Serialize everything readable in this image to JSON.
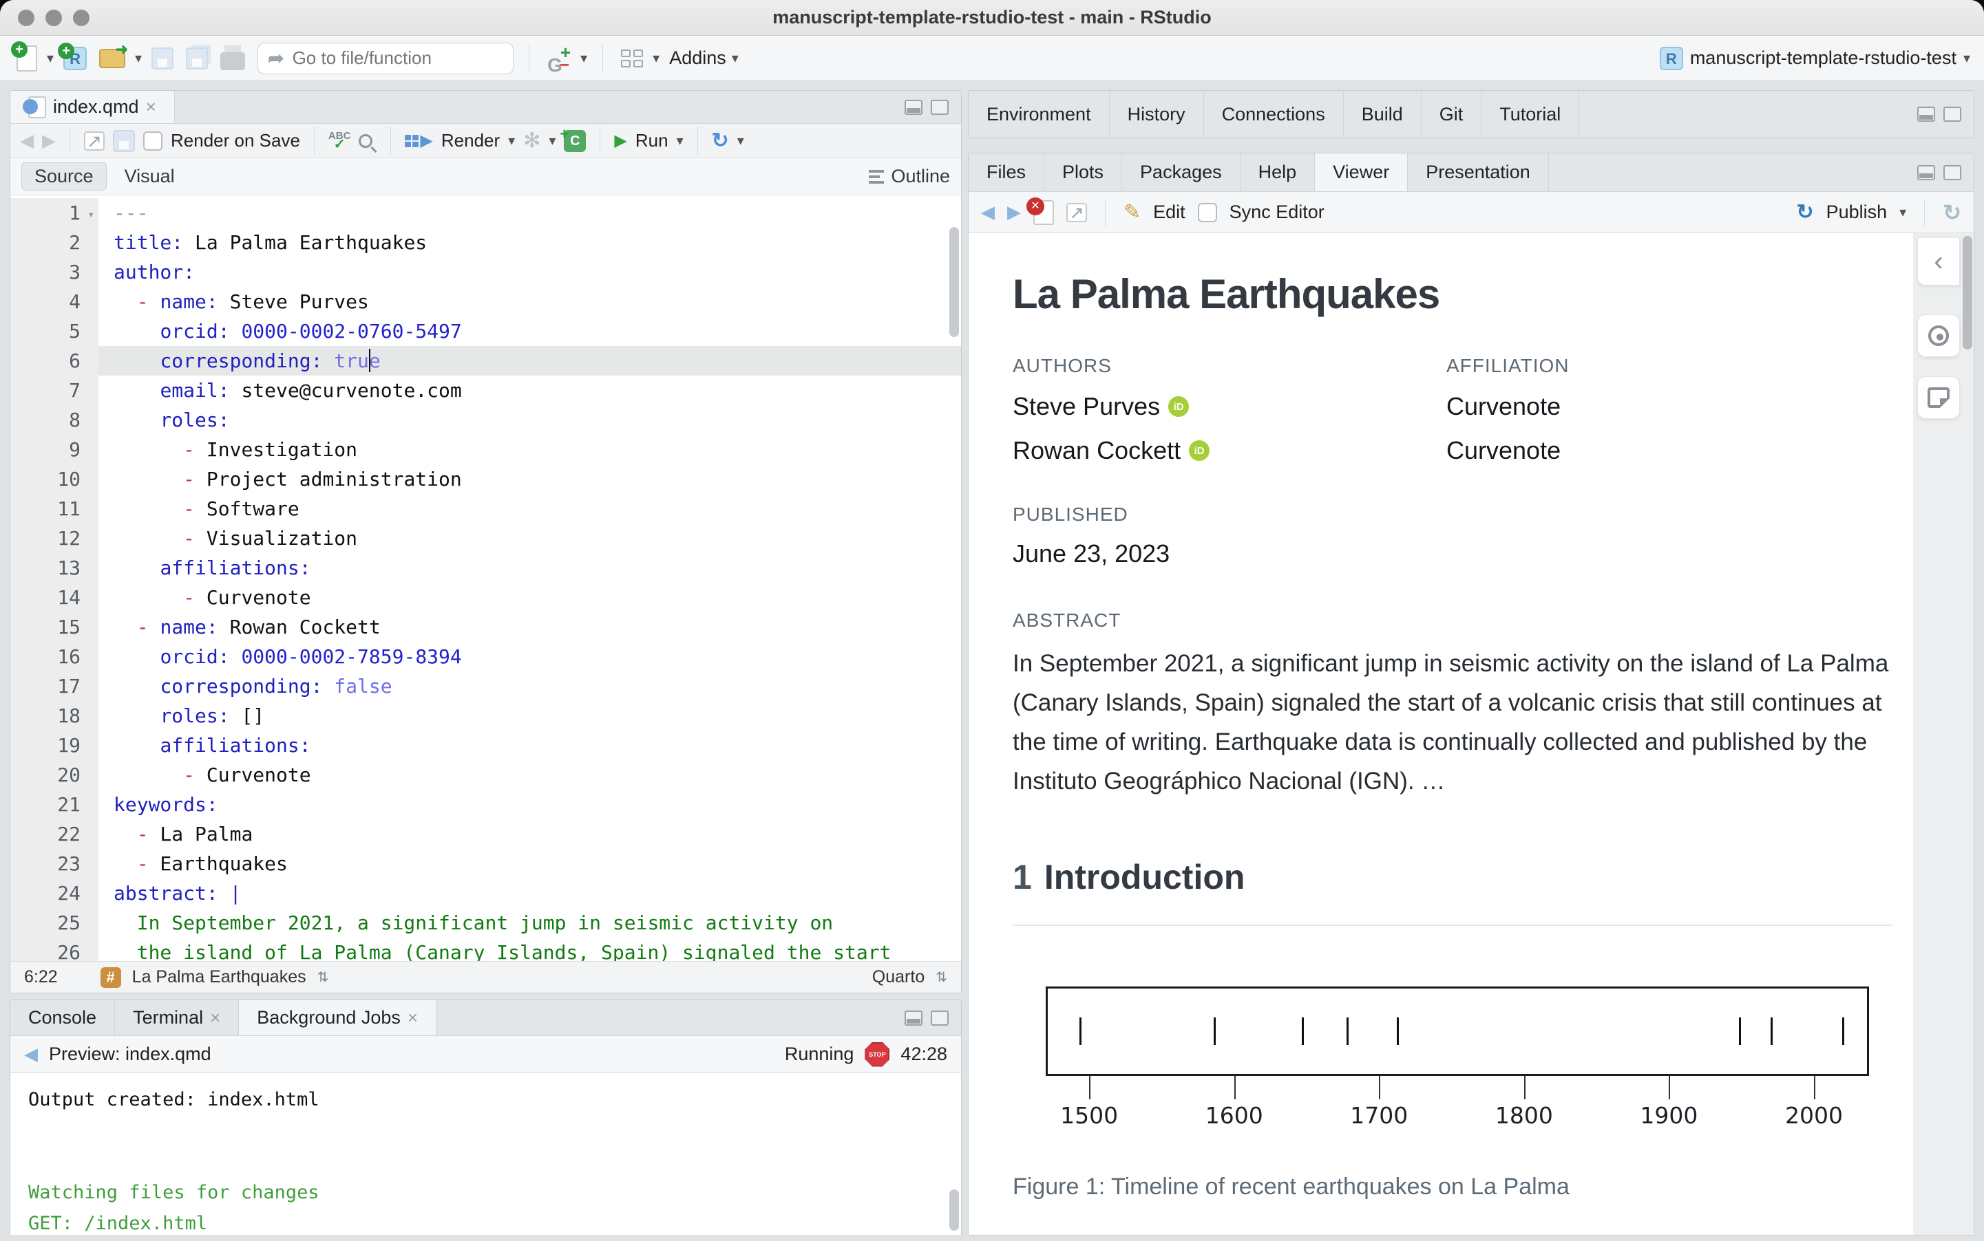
{
  "window": {
    "title": "manuscript-template-rstudio-test - main - RStudio"
  },
  "main_toolbar": {
    "goto_placeholder": "Go to file/function",
    "addins_label": "Addins",
    "project_name": "manuscript-template-rstudio-test"
  },
  "editor": {
    "tab": "index.qmd",
    "toolbar": {
      "render_on_save": "Render on Save",
      "render_label": "Render",
      "run_label": "Run"
    },
    "views": {
      "source": "Source",
      "visual": "Visual",
      "outline": "Outline"
    },
    "cursor": {
      "line": 6,
      "col": 22
    },
    "lines": [
      {
        "n": 1,
        "s": [
          [
            "meta",
            "---"
          ]
        ]
      },
      {
        "n": 2,
        "s": [
          [
            "key",
            "title:"
          ],
          [
            "txt",
            " La Palma Earthquakes"
          ]
        ]
      },
      {
        "n": 3,
        "s": [
          [
            "key",
            "author:"
          ]
        ]
      },
      {
        "n": 4,
        "s": [
          [
            "txt",
            "  "
          ],
          [
            "dash",
            "-"
          ],
          [
            "txt",
            " "
          ],
          [
            "key",
            "name:"
          ],
          [
            "txt",
            " Steve Purves"
          ]
        ]
      },
      {
        "n": 5,
        "s": [
          [
            "txt",
            "    "
          ],
          [
            "key",
            "orcid:"
          ],
          [
            "num",
            " 0000-0002-0760-5497"
          ]
        ]
      },
      {
        "n": 6,
        "s": [
          [
            "txt",
            "    "
          ],
          [
            "key",
            "corresponding:"
          ],
          [
            "bool",
            " true"
          ]
        ]
      },
      {
        "n": 7,
        "s": [
          [
            "txt",
            "    "
          ],
          [
            "key",
            "email:"
          ],
          [
            "txt",
            " steve@curvenote.com"
          ]
        ]
      },
      {
        "n": 8,
        "s": [
          [
            "txt",
            "    "
          ],
          [
            "key",
            "roles:"
          ]
        ]
      },
      {
        "n": 9,
        "s": [
          [
            "txt",
            "      "
          ],
          [
            "dash",
            "-"
          ],
          [
            "txt",
            " Investigation"
          ]
        ]
      },
      {
        "n": 10,
        "s": [
          [
            "txt",
            "      "
          ],
          [
            "dash",
            "-"
          ],
          [
            "txt",
            " Project administration"
          ]
        ]
      },
      {
        "n": 11,
        "s": [
          [
            "txt",
            "      "
          ],
          [
            "dash",
            "-"
          ],
          [
            "txt",
            " Software"
          ]
        ]
      },
      {
        "n": 12,
        "s": [
          [
            "txt",
            "      "
          ],
          [
            "dash",
            "-"
          ],
          [
            "txt",
            " Visualization"
          ]
        ]
      },
      {
        "n": 13,
        "s": [
          [
            "txt",
            "    "
          ],
          [
            "key",
            "affiliations:"
          ]
        ]
      },
      {
        "n": 14,
        "s": [
          [
            "txt",
            "      "
          ],
          [
            "dash",
            "-"
          ],
          [
            "txt",
            " Curvenote"
          ]
        ]
      },
      {
        "n": 15,
        "s": [
          [
            "txt",
            "  "
          ],
          [
            "dash",
            "-"
          ],
          [
            "txt",
            " "
          ],
          [
            "key",
            "name:"
          ],
          [
            "txt",
            " Rowan Cockett"
          ]
        ]
      },
      {
        "n": 16,
        "s": [
          [
            "txt",
            "    "
          ],
          [
            "key",
            "orcid:"
          ],
          [
            "num",
            " 0000-0002-7859-8394"
          ]
        ]
      },
      {
        "n": 17,
        "s": [
          [
            "txt",
            "    "
          ],
          [
            "key",
            "corresponding:"
          ],
          [
            "bool",
            " false"
          ]
        ]
      },
      {
        "n": 18,
        "s": [
          [
            "txt",
            "    "
          ],
          [
            "key",
            "roles:"
          ],
          [
            "txt",
            " []"
          ]
        ]
      },
      {
        "n": 19,
        "s": [
          [
            "txt",
            "    "
          ],
          [
            "key",
            "affiliations:"
          ]
        ]
      },
      {
        "n": 20,
        "s": [
          [
            "txt",
            "      "
          ],
          [
            "dash",
            "-"
          ],
          [
            "txt",
            " Curvenote"
          ]
        ]
      },
      {
        "n": 21,
        "s": [
          [
            "key",
            "keywords:"
          ]
        ]
      },
      {
        "n": 22,
        "s": [
          [
            "txt",
            "  "
          ],
          [
            "dash",
            "-"
          ],
          [
            "txt",
            " La Palma"
          ]
        ]
      },
      {
        "n": 23,
        "s": [
          [
            "txt",
            "  "
          ],
          [
            "dash",
            "-"
          ],
          [
            "txt",
            " Earthquakes"
          ]
        ]
      },
      {
        "n": 24,
        "s": [
          [
            "key",
            "abstract:"
          ],
          [
            "key",
            " |"
          ]
        ]
      },
      {
        "n": 25,
        "s": [
          [
            "str",
            "  In September 2021, a significant jump in seismic activity on"
          ]
        ]
      },
      {
        "n": 26,
        "s": [
          [
            "str",
            "  the island of La Palma (Canary Islands, Spain) signaled the start"
          ]
        ]
      }
    ],
    "status": {
      "position": "6:22",
      "scope": "La Palma Earthquakes",
      "mode": "Quarto"
    }
  },
  "console": {
    "tabs": [
      {
        "label": "Console",
        "closable": false
      },
      {
        "label": "Terminal",
        "closable": true
      },
      {
        "label": "Background Jobs",
        "closable": true
      }
    ],
    "active": "Background Jobs",
    "preview_label": "Preview: index.qmd",
    "status": "Running",
    "stop_label": "STOP",
    "elapsed": "42:28",
    "output": [
      {
        "style": "plain",
        "text": "Output created: index.html"
      },
      {
        "style": "plain",
        "text": ""
      },
      {
        "style": "plain",
        "text": ""
      },
      {
        "style": "green",
        "text": "Watching files for changes"
      },
      {
        "style": "green",
        "text": "GET: /index.html"
      }
    ]
  },
  "right_top": {
    "tabs": [
      "Environment",
      "History",
      "Connections",
      "Build",
      "Git",
      "Tutorial"
    ]
  },
  "viewer": {
    "tabs": [
      "Files",
      "Plots",
      "Packages",
      "Help",
      "Viewer",
      "Presentation"
    ],
    "active": "Viewer",
    "toolbar": {
      "edit": "Edit",
      "sync_editor": "Sync Editor",
      "publish": "Publish"
    }
  },
  "document": {
    "title": "La Palma Earthquakes",
    "authors_label": "AUTHORS",
    "affiliation_label": "AFFILIATION",
    "authors": [
      {
        "name": "Steve Purves",
        "affiliation": "Curvenote"
      },
      {
        "name": "Rowan Cockett",
        "affiliation": "Curvenote"
      }
    ],
    "published_label": "PUBLISHED",
    "published": "June 23, 2023",
    "abstract_label": "ABSTRACT",
    "abstract": "In September 2021, a significant jump in seismic activity on the island of La Palma (Canary Islands, Spain) signaled the start of a volcanic crisis that still continues at the time of writing. Earthquake data is continually collected and published by the Instituto Geográphico Nacional (IGN). …",
    "section": {
      "number": "1",
      "title": "Introduction"
    },
    "figure_caption": "Figure 1: Timeline of recent earthquakes on La Palma"
  },
  "chart_data": {
    "type": "rug-timeline",
    "title": "Timeline of recent earthquakes on La Palma",
    "events_years": [
      1492,
      1585,
      1646,
      1677,
      1712,
      1949,
      1971,
      2021
    ],
    "x_ticks": [
      1500,
      1600,
      1700,
      1800,
      1900,
      2000
    ],
    "xlim": [
      1470,
      2038
    ],
    "xlabel": "",
    "ylabel": "",
    "grid": false,
    "caption": "Figure 1: Timeline of recent earthquakes on La Palma"
  },
  "colors": {
    "accent_blue": "#4c8dd2",
    "orcid_green": "#a6ce39",
    "stop_red": "#d8383f",
    "quarto_orange": "#cb8f3e",
    "yaml_key_blue": "#2020bf",
    "yaml_dash_magenta": "#c0267e",
    "yaml_bool_purple": "#6f6fe8",
    "string_green": "#127a12",
    "console_green": "#3f9e3c",
    "run_green": "#37a139"
  },
  "icons": {
    "chevron_down": "▾",
    "back_arrow": "◀",
    "forward_arrow": "▶",
    "popout": "↗",
    "goto_arrow": "➦",
    "run_arrow": "▶",
    "rerun": "↻",
    "publish": "↻",
    "refresh": "↻",
    "pencil": "✎",
    "check": "✓",
    "collapse_chevron": "‹",
    "close": "×",
    "updown": "⇅"
  }
}
